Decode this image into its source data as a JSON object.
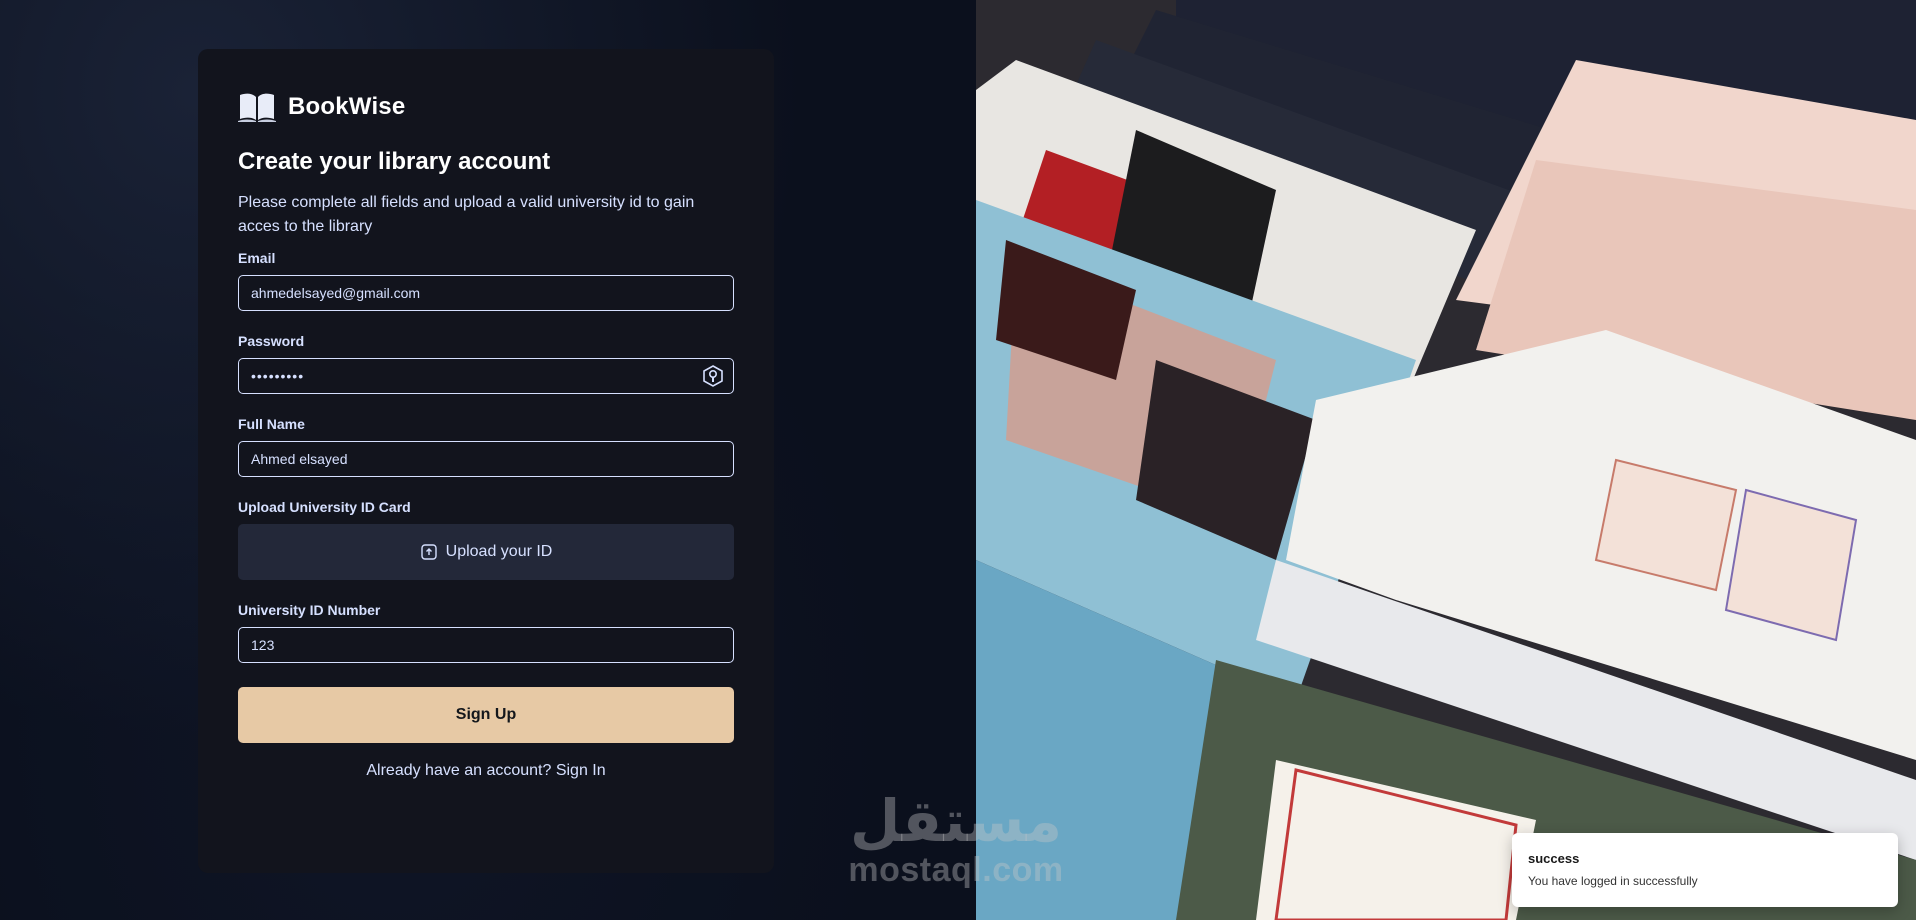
{
  "brand": {
    "name": "BookWise",
    "icon": "open-book-icon"
  },
  "form": {
    "title": "Create your library account",
    "subtitle": "Please complete all fields and upload a valid university id to gain acces to the library",
    "email": {
      "label": "Email",
      "value": "ahmedelsayed@gmail.com"
    },
    "password": {
      "label": "Password",
      "value": "•••••••••",
      "toggle_icon": "eye-icon"
    },
    "full_name": {
      "label": "Full Name",
      "value": "Ahmed elsayed"
    },
    "upload": {
      "label": "Upload University ID Card",
      "button_label": "Upload your ID",
      "icon": "upload-icon"
    },
    "university_id": {
      "label": "University ID Number",
      "value": "123"
    },
    "submit_label": "Sign Up",
    "signin_prompt": "Already have an account?",
    "signin_link": "Sign In"
  },
  "toast": {
    "title": "success",
    "description": "You have logged in successfully"
  },
  "watermark": {
    "arabic": "مستقل",
    "latin": "mostaql.com"
  },
  "colors": {
    "page_bg": "#0b101d",
    "card_bg": "#12141d",
    "text": "#d6e0ff",
    "accent": "#e7c9a5",
    "upload_bg": "#232839"
  }
}
